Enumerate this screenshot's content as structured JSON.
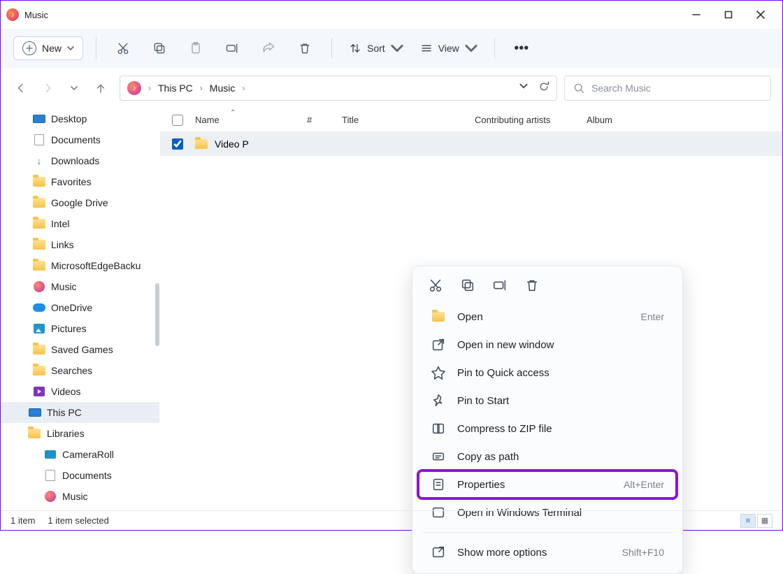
{
  "window": {
    "title": "Music"
  },
  "toolbar": {
    "new_label": "New",
    "sort_label": "Sort",
    "view_label": "View"
  },
  "breadcrumb": {
    "root": "This PC",
    "current": "Music"
  },
  "search": {
    "placeholder": "Search Music"
  },
  "columns": {
    "name": "Name",
    "num": "#",
    "title": "Title",
    "artist": "Contributing artists",
    "album": "Album"
  },
  "files": {
    "row0_name": "Video P"
  },
  "sidebar": {
    "items": [
      "Desktop",
      "Documents",
      "Downloads",
      "Favorites",
      "Google Drive",
      "Intel",
      "Links",
      "MicrosoftEdgeBacku",
      "Music",
      "OneDrive",
      "Pictures",
      "Saved Games",
      "Searches",
      "Videos",
      "This PC",
      "Libraries",
      "CameraRoll",
      "Documents",
      "Music"
    ]
  },
  "context": {
    "open": "Open",
    "open_short": "Enter",
    "open_new": "Open in new window",
    "pin_quick": "Pin to Quick access",
    "pin_start": "Pin to Start",
    "zip": "Compress to ZIP file",
    "copy_path": "Copy as path",
    "properties": "Properties",
    "properties_short": "Alt+Enter",
    "terminal": "Open in Windows Terminal",
    "more": "Show more options",
    "more_short": "Shift+F10"
  },
  "status": {
    "count": "1 item",
    "selected": "1 item selected"
  }
}
